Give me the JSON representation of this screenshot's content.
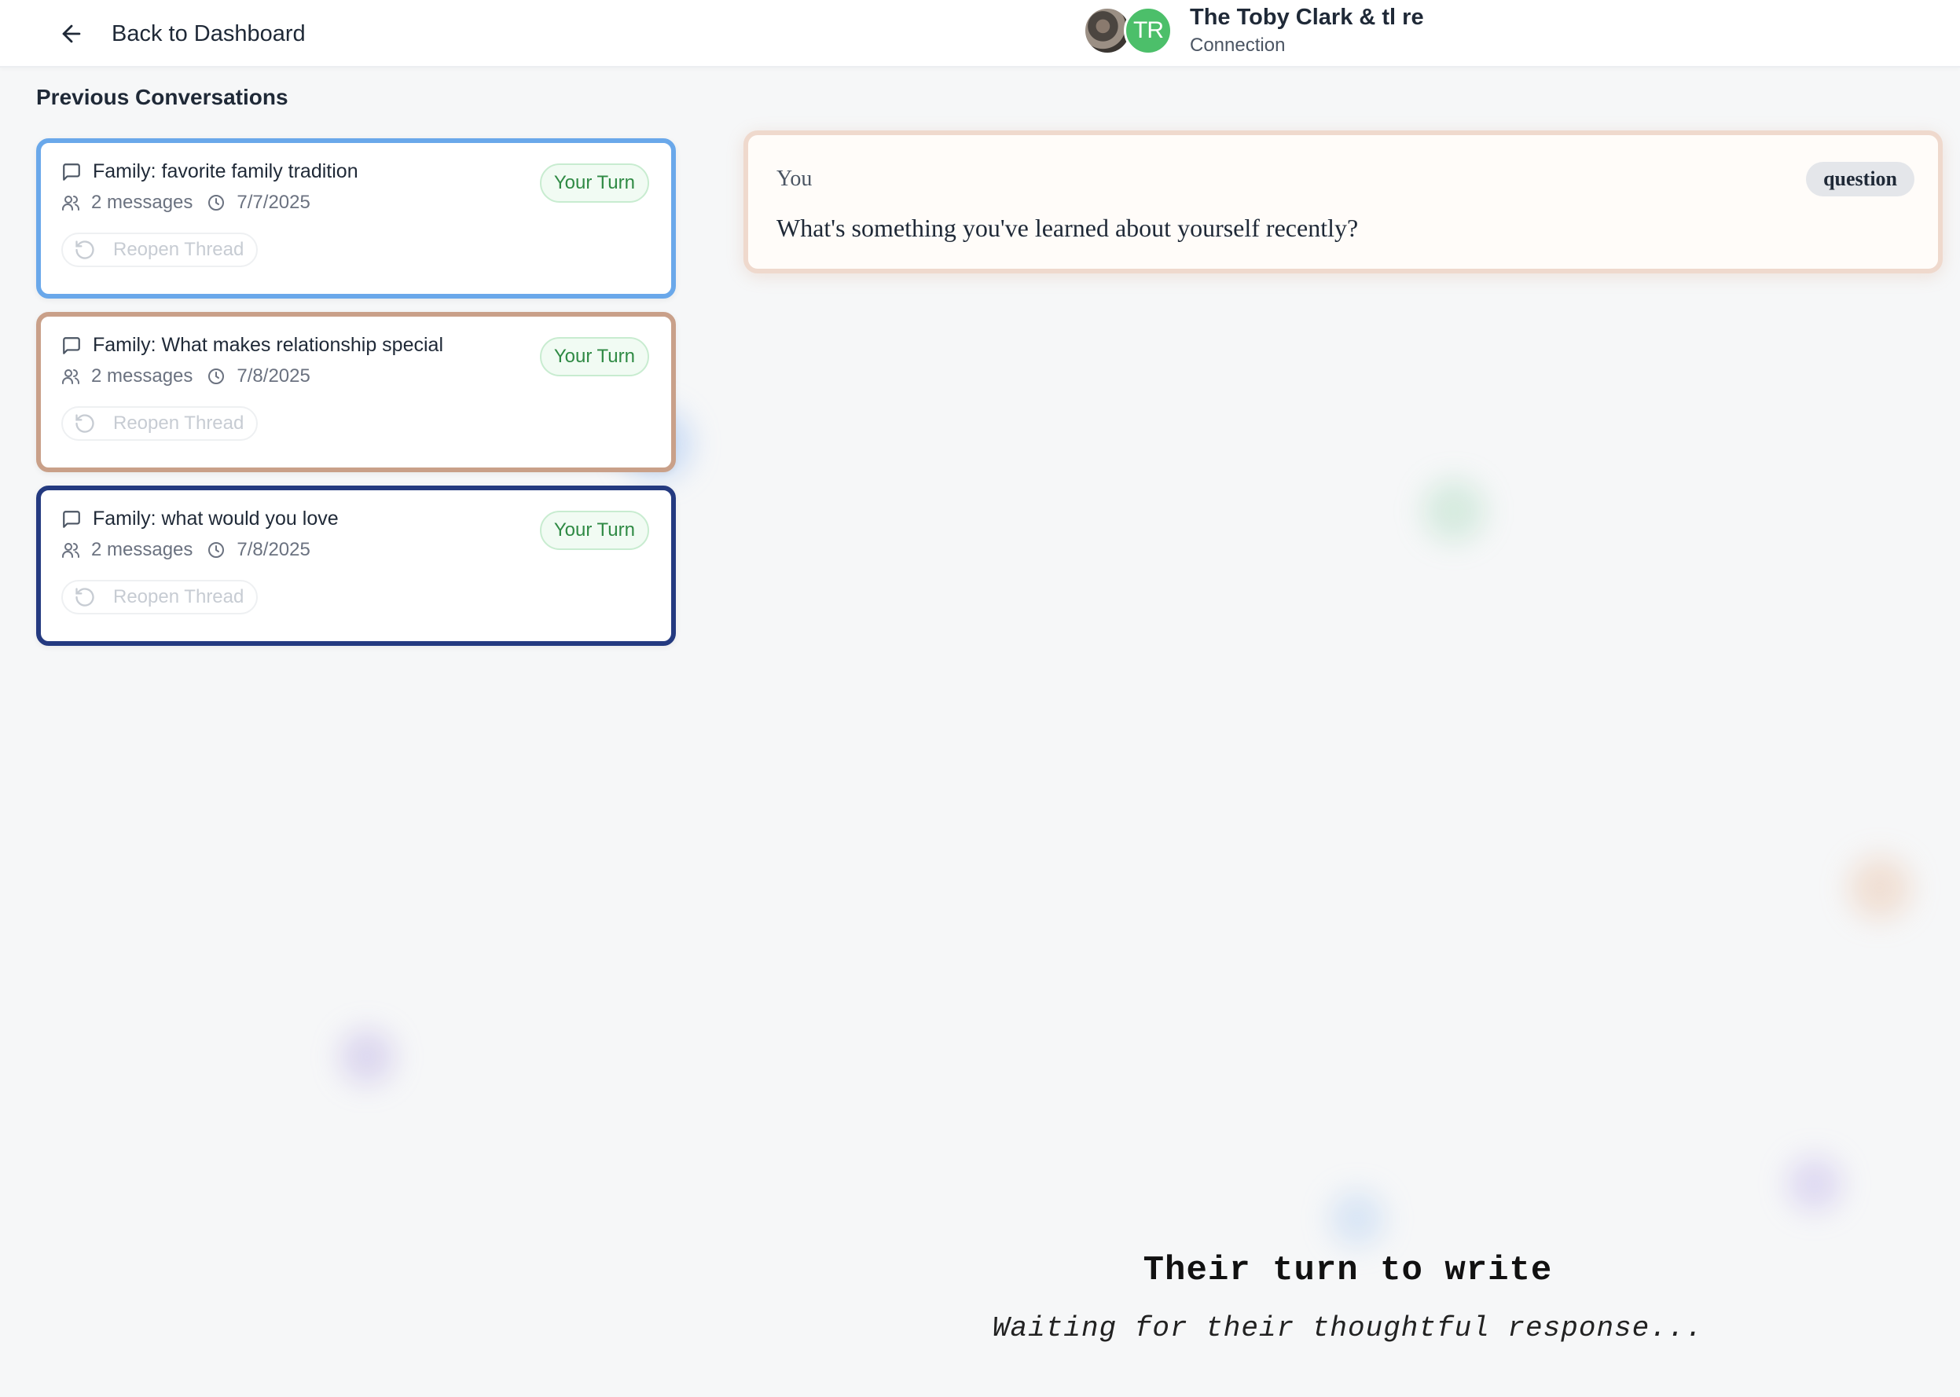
{
  "header": {
    "back_label": "Back to Dashboard",
    "avatar_initials": "TR",
    "connection_name": "The Toby Clark & tl re",
    "connection_type": "Connection"
  },
  "sidebar": {
    "title": "Previous Conversations",
    "threads": [
      {
        "title": "Family: favorite family tradition",
        "messages": "2 messages",
        "date": "7/7/2025",
        "status": "Your Turn",
        "action": "Reopen Thread",
        "accent": "#6aa8ea"
      },
      {
        "title": "Family: What makes relationship special",
        "messages": "2 messages",
        "date": "7/8/2025",
        "status": "Your Turn",
        "action": "Reopen Thread",
        "accent": "#c9a089"
      },
      {
        "title": "Family: what would you love",
        "messages": "2 messages",
        "date": "7/8/2025",
        "status": "Your Turn",
        "action": "Reopen Thread",
        "accent": "#243a80"
      }
    ]
  },
  "message": {
    "author": "You",
    "type": "question",
    "text": "What's something you've learned about yourself recently?"
  },
  "waiting": {
    "title": "Their turn to write",
    "subtitle": "Waiting for their thoughtful response..."
  },
  "colors": {
    "status_green": "#2f8a44",
    "avatar_green": "#4cbf6a"
  }
}
